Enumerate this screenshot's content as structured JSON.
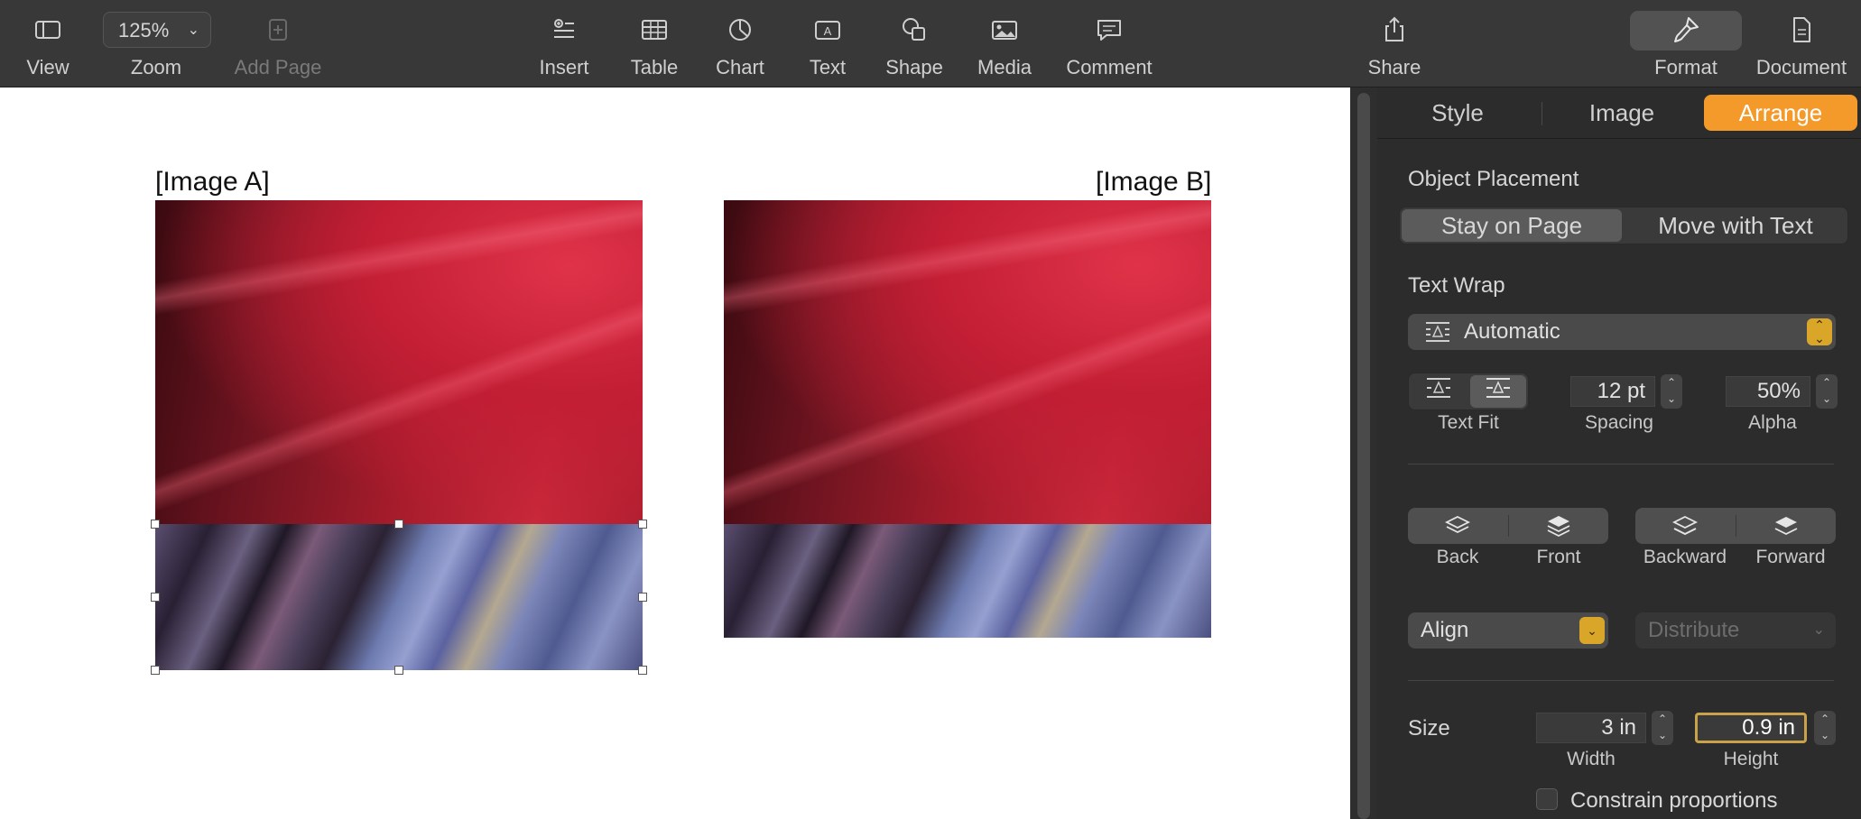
{
  "toolbar": {
    "view": {
      "label": "View",
      "icon": "sidebar-icon"
    },
    "zoom": {
      "label": "Zoom",
      "value": "125%"
    },
    "add_page": {
      "label": "Add Page",
      "icon": "add-page-icon"
    },
    "insert": {
      "label": "Insert",
      "icon": "insert-icon"
    },
    "table": {
      "label": "Table",
      "icon": "table-icon"
    },
    "chart": {
      "label": "Chart",
      "icon": "chart-icon"
    },
    "text": {
      "label": "Text",
      "icon": "text-box-icon"
    },
    "shape": {
      "label": "Shape",
      "icon": "shape-icon"
    },
    "media": {
      "label": "Media",
      "icon": "media-icon"
    },
    "comment": {
      "label": "Comment",
      "icon": "comment-icon"
    },
    "share": {
      "label": "Share",
      "icon": "share-icon"
    },
    "format": {
      "label": "Format",
      "icon": "paintbrush-icon"
    },
    "document": {
      "label": "Document",
      "icon": "document-icon"
    }
  },
  "canvas": {
    "image_a_label": "[Image A]",
    "image_b_label": "[Image B]"
  },
  "sidebar": {
    "tabs": [
      "Style",
      "Image",
      "Arrange"
    ],
    "active_tab": "Arrange",
    "object_placement": {
      "title": "Object Placement",
      "options": [
        "Stay on Page",
        "Move with Text"
      ],
      "selected": "Stay on Page"
    },
    "text_wrap": {
      "title": "Text Wrap",
      "value": "Automatic",
      "text_fit_label": "Text Fit",
      "spacing_value": "12 pt",
      "spacing_label": "Spacing",
      "alpha_value": "50%",
      "alpha_label": "Alpha"
    },
    "layer_buttons": {
      "back": "Back",
      "front": "Front",
      "backward": "Backward",
      "forward": "Forward"
    },
    "align": "Align",
    "distribute": "Distribute",
    "size": {
      "title": "Size",
      "width_value": "3 in",
      "width_label": "Width",
      "height_value": "0.9 in",
      "height_label": "Height",
      "constrain_label": "Constrain proportions",
      "constrain_checked": false
    }
  },
  "colors": {
    "accent": "#f39a2b",
    "popup_arrow": "#d9a62a",
    "focus_ring": "#c9a24a"
  }
}
